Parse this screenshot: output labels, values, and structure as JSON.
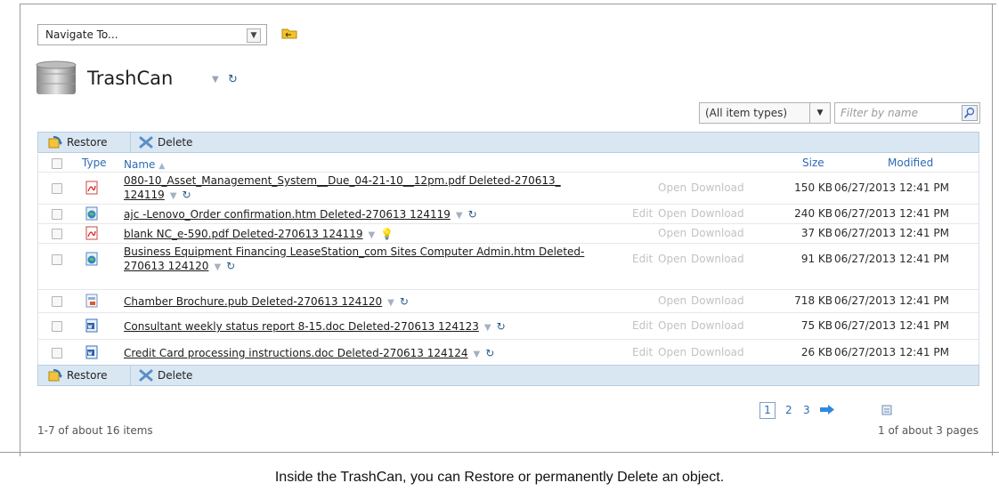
{
  "navigate": {
    "label": "Navigate To..."
  },
  "header": {
    "title": "TrashCan"
  },
  "filter": {
    "type_label": "(All item types)",
    "name_placeholder": "Filter by name"
  },
  "toolbar": {
    "restore_label": "Restore",
    "delete_label": "Delete"
  },
  "columns": {
    "type": "Type",
    "name": "Name",
    "size": "Size",
    "modified": "Modified"
  },
  "rows": [
    {
      "name_line1": "080-10_Asset_Management_System__Due_04-21-10__12pm.pdf Deleted-270613_",
      "name_line2": "124119",
      "icon": "pdf-icon",
      "actions": [
        "Open",
        "Download"
      ],
      "size": "150 KB",
      "modified": "06/27/2013 12:41 PM",
      "marker": "refresh"
    },
    {
      "name_line1": "ajc -Lenovo_Order confirmation.htm Deleted-270613 124119",
      "name_line2": "",
      "icon": "web-page-icon",
      "actions": [
        "Edit",
        "Open",
        "Download"
      ],
      "size": "240 KB",
      "modified": "06/27/2013 12:41 PM",
      "marker": "refresh"
    },
    {
      "name_line1": "blank NC_e-590.pdf Deleted-270613 124119",
      "name_line2": "",
      "icon": "pdf-icon",
      "actions": [
        "Open",
        "Download"
      ],
      "size": "37 KB",
      "modified": "06/27/2013 12:41 PM",
      "marker": "bulb"
    },
    {
      "name_line1": "Business Equipment Financing LeaseStation_com Sites Computer Admin.htm Deleted-",
      "name_line2": "270613 124120",
      "icon": "web-page-icon",
      "actions": [
        "Edit",
        "Open",
        "Download"
      ],
      "size": "91 KB",
      "modified": "06/27/2013 12:41 PM",
      "marker": "refresh"
    },
    {
      "name_line1": "Chamber Brochure.pub Deleted-270613 124120",
      "name_line2": "",
      "icon": "publisher-icon",
      "actions": [
        "Open",
        "Download"
      ],
      "size": "718 KB",
      "modified": "06/27/2013 12:41 PM",
      "marker": "refresh"
    },
    {
      "name_line1": "Consultant weekly status report 8-15.doc Deleted-270613 124123",
      "name_line2": "",
      "icon": "word-doc-icon",
      "actions": [
        "Edit",
        "Open",
        "Download"
      ],
      "size": "75 KB",
      "modified": "06/27/2013 12:41 PM",
      "marker": "refresh"
    },
    {
      "name_line1": "Credit Card processing instructions.doc Deleted-270613 124124",
      "name_line2": "",
      "icon": "word-doc-icon",
      "actions": [
        "Edit",
        "Open",
        "Download"
      ],
      "size": "26 KB",
      "modified": "06/27/2013 12:41 PM",
      "marker": "refresh"
    }
  ],
  "pagination": {
    "pages": [
      "1",
      "2",
      "3"
    ],
    "current": "1",
    "items_summary": "1-7 of about 16 items",
    "pages_summary": "1 of about 3 pages"
  },
  "caption": "Inside the TrashCan, you can Restore or permanently Delete an object.",
  "colors": {
    "toolbar_bg": "#d9e7f3",
    "link_blue": "#2e6ab4",
    "disabled_gray": "#c2c2c2"
  }
}
